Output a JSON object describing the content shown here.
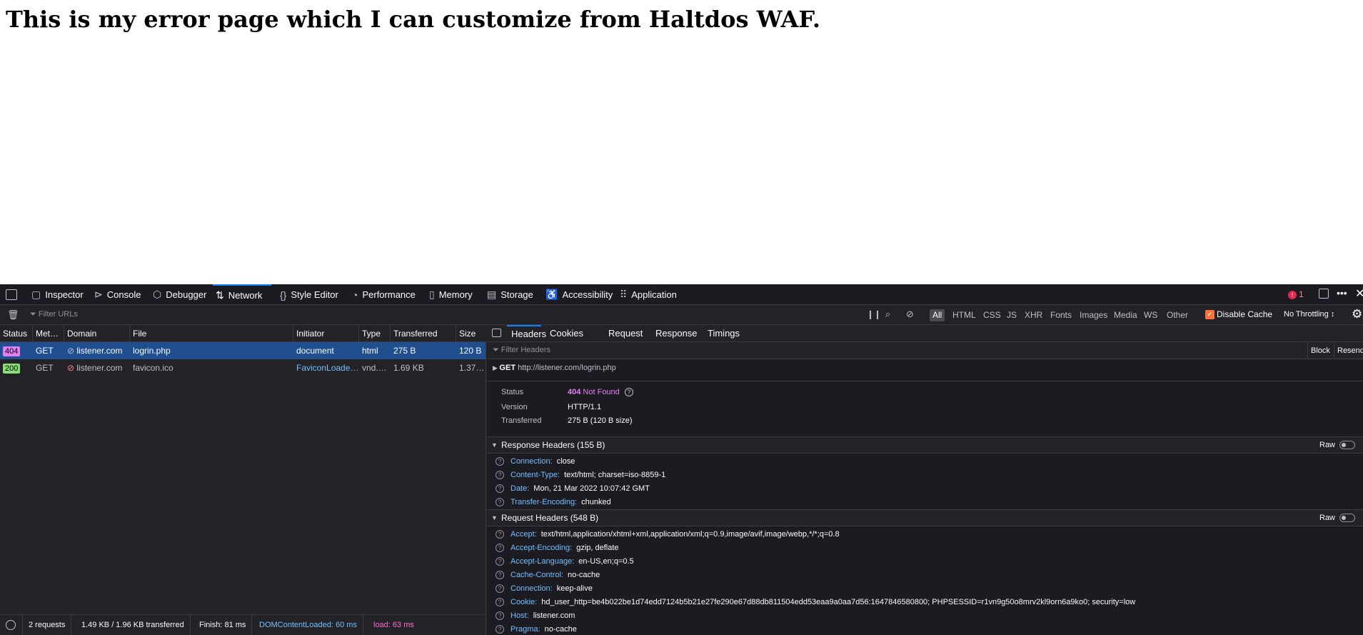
{
  "page": {
    "heading": "This is my error page which I can customize from Haltdos WAF."
  },
  "toolbox": {
    "tabs": [
      {
        "label": "Inspector",
        "icon": "inspector-icon"
      },
      {
        "label": "Console",
        "icon": "console-icon"
      },
      {
        "label": "Debugger",
        "icon": "debugger-icon"
      },
      {
        "label": "Network",
        "icon": "network-icon"
      },
      {
        "label": "Style Editor",
        "icon": "style-editor-icon"
      },
      {
        "label": "Performance",
        "icon": "performance-icon"
      },
      {
        "label": "Memory",
        "icon": "memory-icon"
      },
      {
        "label": "Storage",
        "icon": "storage-icon"
      },
      {
        "label": "Accessibility",
        "icon": "accessibility-icon"
      },
      {
        "label": "Application",
        "icon": "application-icon"
      }
    ],
    "active_tab": "Network",
    "error_count": "1"
  },
  "filter": {
    "placeholder": "Filter URLs",
    "types": [
      "All",
      "HTML",
      "CSS",
      "JS",
      "XHR",
      "Fonts",
      "Images",
      "Media",
      "WS",
      "Other"
    ],
    "active_type": "All",
    "disable_cache_label": "Disable Cache",
    "throttling": "No Throttling ↕"
  },
  "request_table": {
    "columns": [
      "Status",
      "Met…",
      "Domain",
      "File",
      "Initiator",
      "Type",
      "Transferred",
      "Size"
    ],
    "rows": [
      {
        "status": "404",
        "method": "GET",
        "domain": "listener.com",
        "file": "logrin.php",
        "initiator": "document",
        "type": "html",
        "transferred": "275 B",
        "size": "120 B",
        "selected": true
      },
      {
        "status": "200",
        "method": "GET",
        "domain": "listener.com",
        "file": "favicon.ico",
        "initiator": "FaviconLoade…",
        "type": "vnd.…",
        "transferred": "1.69 KB",
        "size": "1.37…",
        "selected": false
      }
    ]
  },
  "status_bar": {
    "requests": "2 requests",
    "transferred": "1.49 KB / 1.96 KB transferred",
    "finish": "Finish: 81 ms",
    "dom_content_loaded": "DOMContentLoaded: 60 ms",
    "load": "load: 63 ms"
  },
  "details": {
    "tabs": [
      "Headers",
      "Cookies",
      "Request",
      "Response",
      "Timings"
    ],
    "active_tab": "Headers",
    "filter_placeholder": "Filter Headers",
    "block_label": "Block",
    "resend_label": "Resend",
    "request_line": {
      "method": "GET",
      "url": "http://listener.com/logrin.php"
    },
    "summary": [
      {
        "name": "Status",
        "value": "404 Not Found"
      },
      {
        "name": "Version",
        "value": "HTTP/1.1"
      },
      {
        "name": "Transferred",
        "value": "275 B (120 B size)"
      }
    ],
    "status_code": "404",
    "status_text": "Not Found",
    "response_headers": {
      "title": "Response Headers (155 B)",
      "raw_label": "Raw",
      "items": [
        {
          "name": "Connection:",
          "value": "close"
        },
        {
          "name": "Content-Type:",
          "value": "text/html; charset=iso-8859-1"
        },
        {
          "name": "Date:",
          "value": "Mon, 21 Mar 2022 10:07:42 GMT"
        },
        {
          "name": "Transfer-Encoding:",
          "value": "chunked"
        }
      ]
    },
    "request_headers": {
      "title": "Request Headers (548 B)",
      "raw_label": "Raw",
      "items": [
        {
          "name": "Accept:",
          "value": "text/html,application/xhtml+xml,application/xml;q=0.9,image/avif,image/webp,*/*;q=0.8"
        },
        {
          "name": "Accept-Encoding:",
          "value": "gzip, deflate"
        },
        {
          "name": "Accept-Language:",
          "value": "en-US,en;q=0.5"
        },
        {
          "name": "Cache-Control:",
          "value": "no-cache"
        },
        {
          "name": "Connection:",
          "value": "keep-alive"
        },
        {
          "name": "Cookie:",
          "value": "hd_user_http=be4b022be1d74edd7124b5b21e27fe290e67d88db811504edd53eaa9a0aa7d56:1647846580800; PHPSESSID=r1vn9g50o8mrv2kl9orn6a9ko0; security=low"
        },
        {
          "name": "Host:",
          "value": "listener.com"
        },
        {
          "name": "Pragma:",
          "value": "no-cache"
        }
      ]
    }
  },
  "colors": {
    "accent": "#0a84ff",
    "status_404": "#e27ff5",
    "status_200": "#86de74",
    "header_name": "#75bfff",
    "load": "#ff6bcf"
  }
}
